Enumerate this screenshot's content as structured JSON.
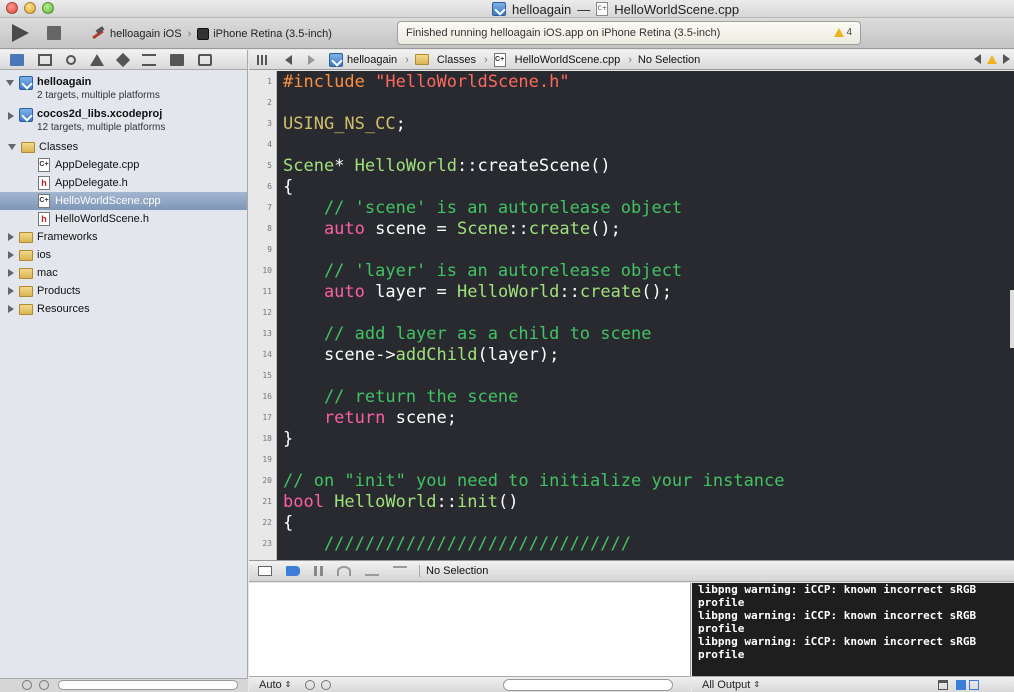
{
  "window": {
    "project": "helloagain",
    "separator": "—",
    "file": "HelloWorldScene.cpp"
  },
  "toolbar": {
    "scheme": "helloagain iOS",
    "destination": "iPhone Retina (3.5-inch)",
    "activity_status": "Finished running helloagain iOS.app on iPhone Retina (3.5-inch)",
    "warning_count": "4"
  },
  "navigator": {
    "items": [
      {
        "label": "helloagain",
        "sub": "2 targets, multiple platforms"
      },
      {
        "label": "cocos2d_libs.xcodeproj",
        "sub": "12 targets, multiple platforms"
      },
      {
        "label": "Classes"
      },
      {
        "label": "AppDelegate.cpp"
      },
      {
        "label": "AppDelegate.h"
      },
      {
        "label": "HelloWorldScene.cpp"
      },
      {
        "label": "HelloWorldScene.h"
      },
      {
        "label": "Frameworks"
      },
      {
        "label": "ios"
      },
      {
        "label": "mac"
      },
      {
        "label": "Products"
      },
      {
        "label": "Resources"
      }
    ]
  },
  "jumpbar": {
    "crumbs": [
      "helloagain",
      "Classes",
      "HelloWorldScene.cpp",
      "No Selection"
    ]
  },
  "editor": {
    "line_numbers": [
      "1",
      "2",
      "3",
      "4",
      "5",
      "6",
      "7",
      "8",
      "9",
      "10",
      "11",
      "12",
      "13",
      "14",
      "15",
      "16",
      "17",
      "18",
      "19",
      "20",
      "21",
      "22",
      "23"
    ],
    "lines": {
      "l1a": "#include ",
      "l1b": "\"HelloWorldScene.h\"",
      "l3": "USING_NS_CC",
      "l3b": ";",
      "l5a": "Scene",
      "l5b": "* ",
      "l5c": "HelloWorld",
      "l5d": "::",
      "l5e": "createScene",
      "l5f": "()",
      "l6": "{",
      "l7": "    // 'scene' is an autorelease object",
      "l8a": "    auto",
      "l8b": " scene = ",
      "l8c": "Scene",
      "l8d": "::",
      "l8e": "create",
      "l8f": "();",
      "l10": "    // 'layer' is an autorelease object",
      "l11a": "    auto",
      "l11b": " layer = ",
      "l11c": "HelloWorld",
      "l11d": "::",
      "l11e": "create",
      "l11f": "();",
      "l13": "    // add layer as a child to scene",
      "l14a": "    scene->",
      "l14b": "addChild",
      "l14c": "(layer);",
      "l16": "    // return the scene",
      "l17a": "    return",
      "l17b": " scene;",
      "l18": "}",
      "l20": "// on \"init\" you need to initialize your instance",
      "l21a": "bool",
      "l21b": " HelloWorld",
      "l21c": "::",
      "l21d": "init",
      "l21e": "()",
      "l22": "{",
      "l23": "    //////////////////////////////"
    }
  },
  "debug": {
    "selection": "No Selection"
  },
  "variables": {
    "scope": "Auto"
  },
  "console": {
    "output": "libpng warning: iCCP: known incorrect sRGB\nprofile\nlibpng warning: iCCP: known incorrect sRGB\nprofile\nlibpng warning: iCCP: known incorrect sRGB\nprofile",
    "filter": "All Output"
  },
  "colors": {
    "editor_bg": "#292a30",
    "keyword": "#fc5fa3",
    "comment": "#41c363",
    "string": "#fc6a5d",
    "type": "#5dd8ff",
    "function": "#a0e07a"
  }
}
